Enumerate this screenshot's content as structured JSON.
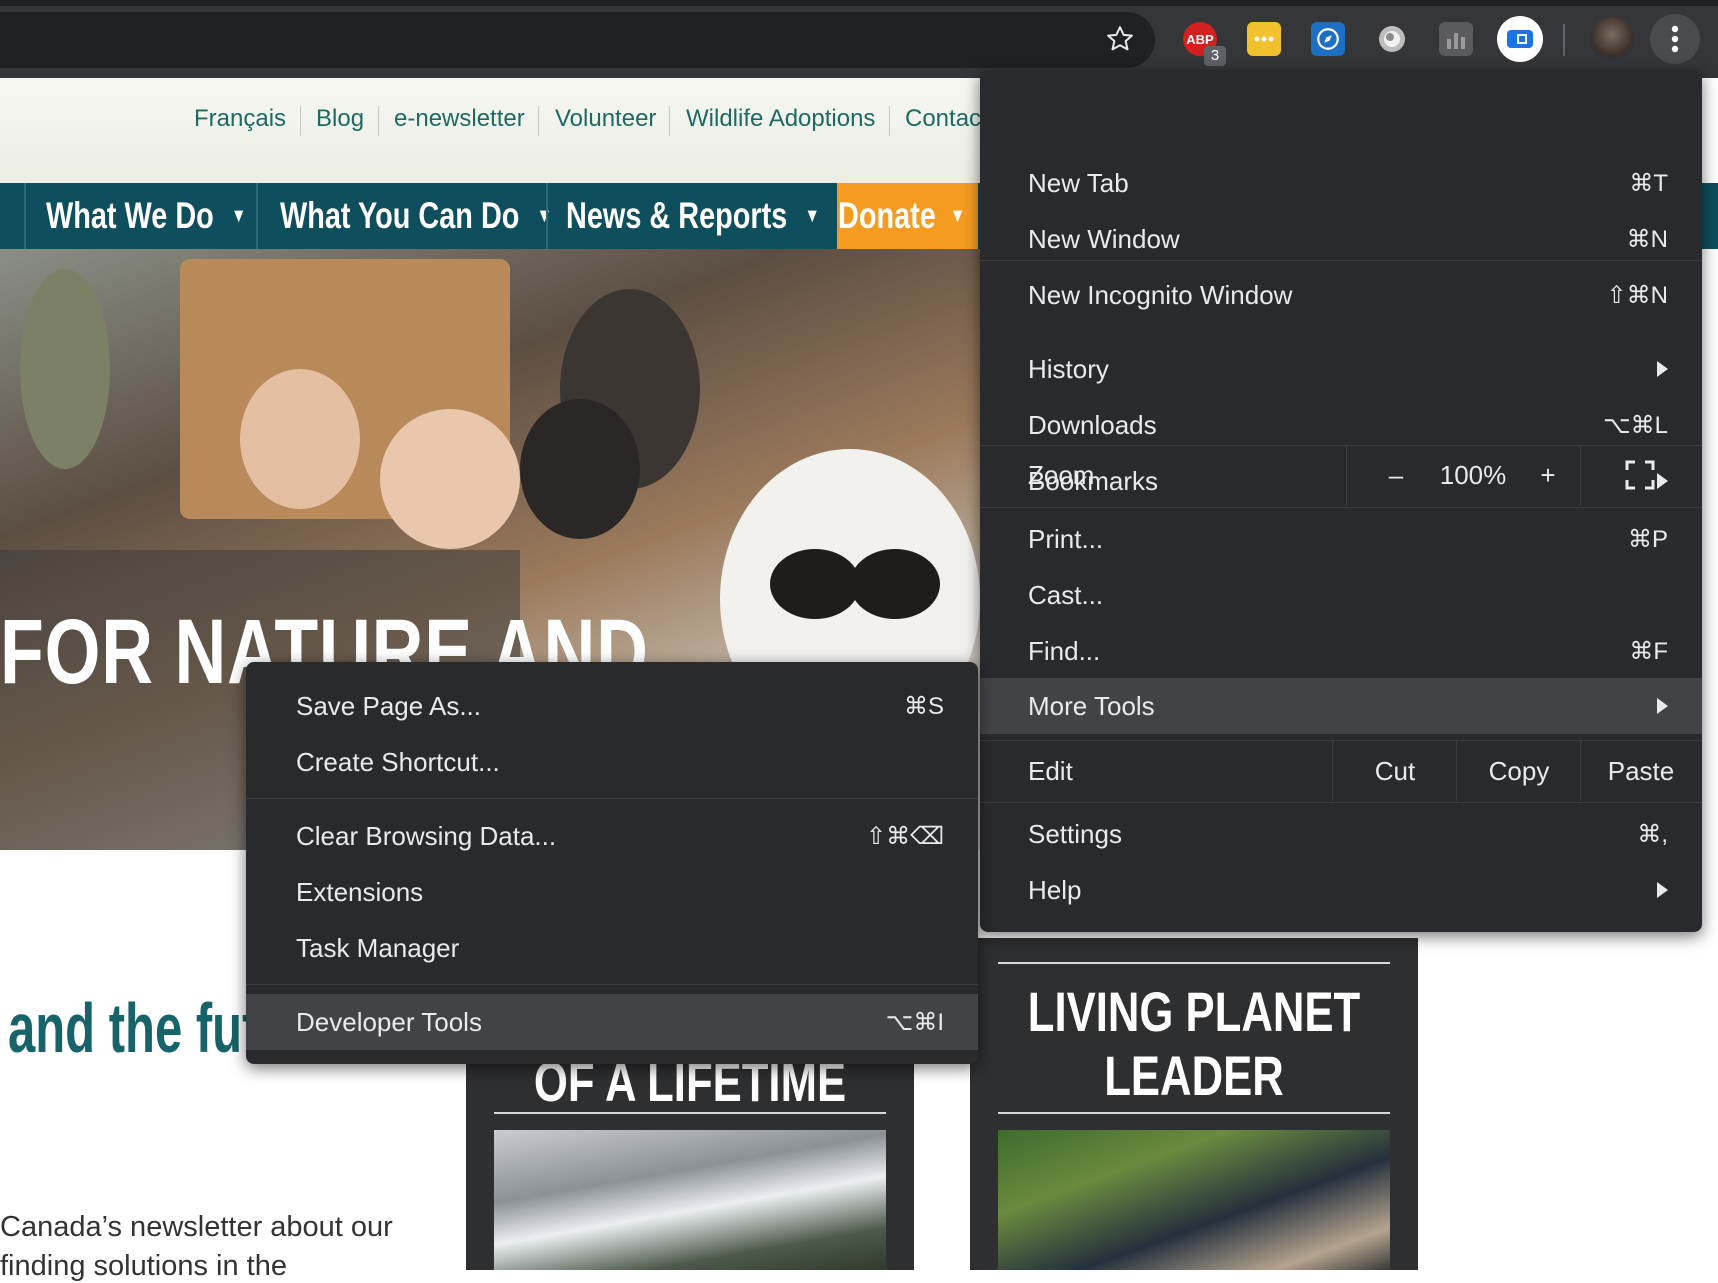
{
  "toolbar": {
    "abp_badge": "ABP",
    "abp_count": "3",
    "icons": [
      "star-icon",
      "adblock-icon",
      "extension-yellow-icon",
      "compass-icon",
      "circle-extension-icon",
      "chart-extension-icon",
      "meet-extension-icon",
      "avatar",
      "kebab-menu-icon"
    ]
  },
  "site": {
    "top_links": [
      "Français",
      "Blog",
      "e-newsletter",
      "Volunteer",
      "Wildlife Adoptions",
      "Contac"
    ],
    "nav": [
      "What We Do",
      "What You Can Do",
      "News & Reports",
      "Donate"
    ],
    "hero_title": "FOR NATURE AND",
    "heading": "and the futu",
    "body_line1": "Canada’s newsletter about our",
    "body_line2": "finding solutions in the",
    "card1_title": "OF A LIFETIME",
    "card2_title_line1": "LIVING PLANET",
    "card2_title_line2": "LEADER"
  },
  "main_menu": {
    "new_tab": {
      "label": "New Tab",
      "shortcut": "⌘T"
    },
    "new_window": {
      "label": "New Window",
      "shortcut": "⌘N"
    },
    "incognito": {
      "label": "New Incognito Window",
      "shortcut": "⇧⌘N"
    },
    "history": {
      "label": "History"
    },
    "downloads": {
      "label": "Downloads",
      "shortcut": "⌥⌘L"
    },
    "bookmarks": {
      "label": "Bookmarks"
    },
    "zoom": {
      "label": "Zoom",
      "minus": "–",
      "value": "100%",
      "plus": "+"
    },
    "print": {
      "label": "Print...",
      "shortcut": "⌘P"
    },
    "cast": {
      "label": "Cast..."
    },
    "find": {
      "label": "Find...",
      "shortcut": "⌘F"
    },
    "more_tools": {
      "label": "More Tools"
    },
    "edit": {
      "label": "Edit",
      "cut": "Cut",
      "copy": "Copy",
      "paste": "Paste"
    },
    "settings": {
      "label": "Settings",
      "shortcut": "⌘,"
    },
    "help": {
      "label": "Help"
    }
  },
  "submenu": {
    "save_page": {
      "label": "Save Page As...",
      "shortcut": "⌘S"
    },
    "create_shortcut": {
      "label": "Create Shortcut..."
    },
    "clear_data": {
      "label": "Clear Browsing Data...",
      "shortcut": "⇧⌘⌫"
    },
    "extensions": {
      "label": "Extensions"
    },
    "task_manager": {
      "label": "Task Manager"
    },
    "dev_tools": {
      "label": "Developer Tools",
      "shortcut": "⌥⌘I"
    }
  },
  "colors": {
    "menu_bg": "#292a2d",
    "menu_highlight": "#414346",
    "nav_bg": "#0f4e5c",
    "donate": "#f59b22",
    "link": "#1a6b62"
  }
}
